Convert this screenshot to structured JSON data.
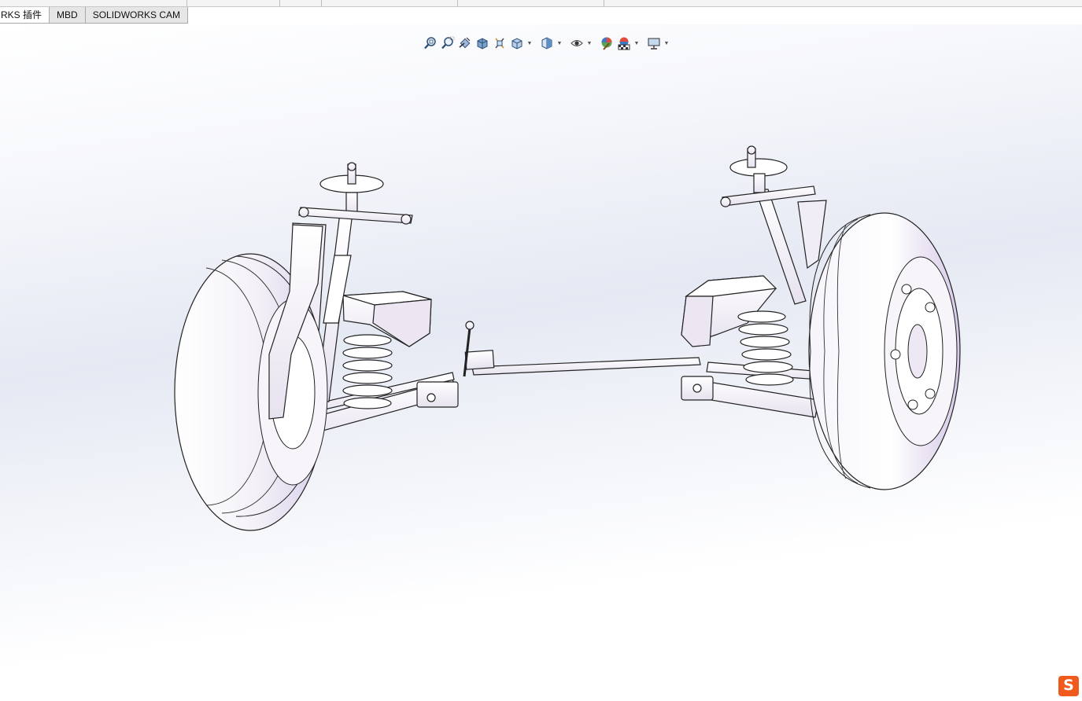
{
  "command_manager": {
    "tabs": [
      {
        "label": "RKS 插件"
      },
      {
        "label": "MBD"
      },
      {
        "label": "SOLIDWORKS CAM"
      }
    ]
  },
  "heads_up_toolbar": {
    "buttons": [
      {
        "icon": "zoom-to-fit-icon"
      },
      {
        "icon": "zoom-to-area-icon"
      },
      {
        "icon": "previous-view-icon"
      },
      {
        "icon": "section-view-icon"
      },
      {
        "icon": "dynamic-annotation-views-icon"
      },
      {
        "icon": "view-orientation-icon",
        "has_dropdown": true
      },
      {
        "icon": "display-style-icon",
        "has_dropdown": true
      },
      {
        "icon": "hide-show-items-icon",
        "has_dropdown": true
      },
      {
        "icon": "edit-appearance-icon"
      },
      {
        "icon": "apply-scene-icon",
        "has_dropdown": true
      },
      {
        "icon": "view-settings-icon",
        "has_dropdown": true
      }
    ]
  },
  "viewport": {
    "model": "front-suspension-assembly",
    "background_colors": [
      "#ffffff",
      "#e5e9f3"
    ],
    "model_tint": "#d9cdea"
  },
  "watermark": {
    "logo": "S",
    "color": "#f05a1c"
  }
}
